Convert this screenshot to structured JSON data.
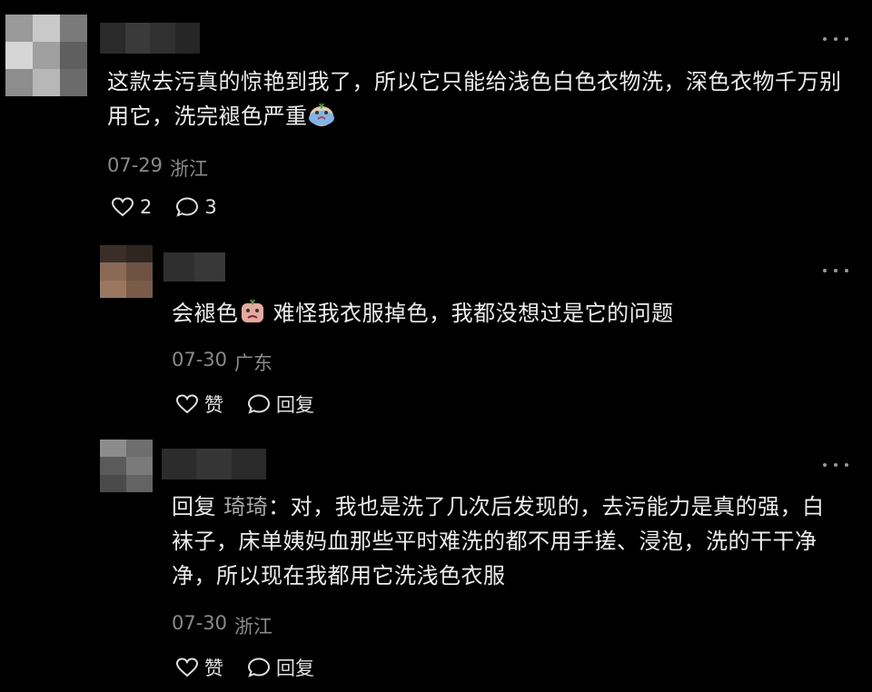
{
  "comments": [
    {
      "text": "这款去污真的惊艳到我了，所以它只能给浅色白色衣物洗，深色衣物千万别用它，洗完褪色严重",
      "date": "07-29",
      "location": "浙江",
      "likes": "2",
      "replies": "3",
      "emoji": "crying-face-emoji"
    },
    {
      "text_before_emoji": "会褪色",
      "text_after_emoji": " 难怪我衣服掉色，我都没想过是它的问题",
      "date": "07-30",
      "location": "广东",
      "like_label": "赞",
      "reply_label": "回复",
      "emoji": "sad-face-emoji"
    },
    {
      "reply_prefix": "回复",
      "reply_to": "琦琦",
      "text": "：对，我也是洗了几次后发现的，去污能力是真的强，白袜子，床单姨妈血那些平时难洗的都不用手搓、浸泡，洗的干干净净，所以现在我都用它洗浅色衣服",
      "date": "07-30",
      "location": "浙江",
      "like_label": "赞",
      "reply_label": "回复"
    }
  ],
  "colors": {
    "background": "#000000",
    "text": "#ececec",
    "meta": "#8a8a8a"
  }
}
